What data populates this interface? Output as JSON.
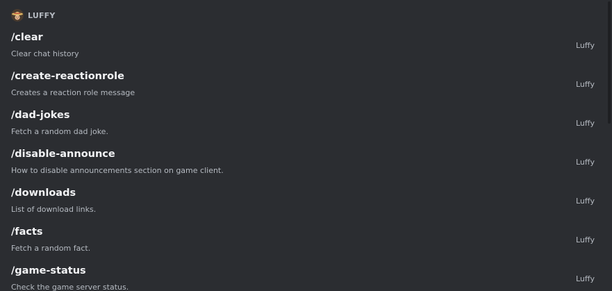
{
  "app": {
    "bot_name": "LUFFY",
    "avatar_icon": "straw-hat-avatar-icon"
  },
  "commands": [
    {
      "name": "/clear",
      "description": "Clear chat history",
      "source": "Luffy"
    },
    {
      "name": "/create-reactionrole",
      "description": "Creates a reaction role message",
      "source": "Luffy"
    },
    {
      "name": "/dad-jokes",
      "description": "Fetch a random dad joke.",
      "source": "Luffy"
    },
    {
      "name": "/disable-announce",
      "description": "How to disable announcements section on game client.",
      "source": "Luffy"
    },
    {
      "name": "/downloads",
      "description": "List of download links.",
      "source": "Luffy"
    },
    {
      "name": "/facts",
      "description": "Fetch a random fact.",
      "source": "Luffy"
    },
    {
      "name": "/game-status",
      "description": "Check the game server status.",
      "source": "Luffy"
    }
  ],
  "colors": {
    "background": "#2b2d31",
    "command_name": "#f2f3f5",
    "secondary_text": "#b5bac1",
    "scrollbar_thumb": "#1e1f22"
  }
}
